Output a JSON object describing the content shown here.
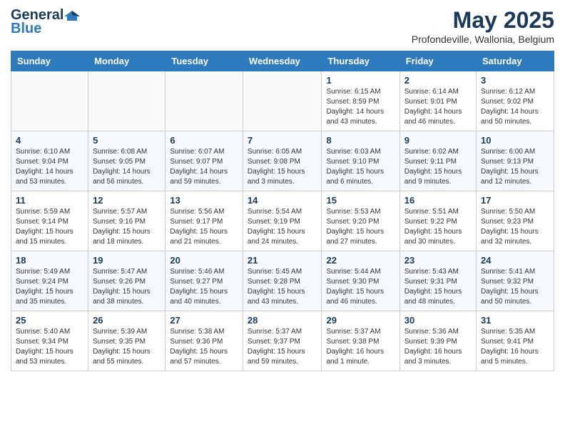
{
  "header": {
    "logo_general": "General",
    "logo_blue": "Blue",
    "month_year": "May 2025",
    "location": "Profondeville, Wallonia, Belgium"
  },
  "columns": [
    "Sunday",
    "Monday",
    "Tuesday",
    "Wednesday",
    "Thursday",
    "Friday",
    "Saturday"
  ],
  "rows": [
    [
      {
        "day": "",
        "detail": ""
      },
      {
        "day": "",
        "detail": ""
      },
      {
        "day": "",
        "detail": ""
      },
      {
        "day": "",
        "detail": ""
      },
      {
        "day": "1",
        "detail": "Sunrise: 6:15 AM\nSunset: 8:59 PM\nDaylight: 14 hours\nand 43 minutes."
      },
      {
        "day": "2",
        "detail": "Sunrise: 6:14 AM\nSunset: 9:01 PM\nDaylight: 14 hours\nand 46 minutes."
      },
      {
        "day": "3",
        "detail": "Sunrise: 6:12 AM\nSunset: 9:02 PM\nDaylight: 14 hours\nand 50 minutes."
      }
    ],
    [
      {
        "day": "4",
        "detail": "Sunrise: 6:10 AM\nSunset: 9:04 PM\nDaylight: 14 hours\nand 53 minutes."
      },
      {
        "day": "5",
        "detail": "Sunrise: 6:08 AM\nSunset: 9:05 PM\nDaylight: 14 hours\nand 56 minutes."
      },
      {
        "day": "6",
        "detail": "Sunrise: 6:07 AM\nSunset: 9:07 PM\nDaylight: 14 hours\nand 59 minutes."
      },
      {
        "day": "7",
        "detail": "Sunrise: 6:05 AM\nSunset: 9:08 PM\nDaylight: 15 hours\nand 3 minutes."
      },
      {
        "day": "8",
        "detail": "Sunrise: 6:03 AM\nSunset: 9:10 PM\nDaylight: 15 hours\nand 6 minutes."
      },
      {
        "day": "9",
        "detail": "Sunrise: 6:02 AM\nSunset: 9:11 PM\nDaylight: 15 hours\nand 9 minutes."
      },
      {
        "day": "10",
        "detail": "Sunrise: 6:00 AM\nSunset: 9:13 PM\nDaylight: 15 hours\nand 12 minutes."
      }
    ],
    [
      {
        "day": "11",
        "detail": "Sunrise: 5:59 AM\nSunset: 9:14 PM\nDaylight: 15 hours\nand 15 minutes."
      },
      {
        "day": "12",
        "detail": "Sunrise: 5:57 AM\nSunset: 9:16 PM\nDaylight: 15 hours\nand 18 minutes."
      },
      {
        "day": "13",
        "detail": "Sunrise: 5:56 AM\nSunset: 9:17 PM\nDaylight: 15 hours\nand 21 minutes."
      },
      {
        "day": "14",
        "detail": "Sunrise: 5:54 AM\nSunset: 9:19 PM\nDaylight: 15 hours\nand 24 minutes."
      },
      {
        "day": "15",
        "detail": "Sunrise: 5:53 AM\nSunset: 9:20 PM\nDaylight: 15 hours\nand 27 minutes."
      },
      {
        "day": "16",
        "detail": "Sunrise: 5:51 AM\nSunset: 9:22 PM\nDaylight: 15 hours\nand 30 minutes."
      },
      {
        "day": "17",
        "detail": "Sunrise: 5:50 AM\nSunset: 9:23 PM\nDaylight: 15 hours\nand 32 minutes."
      }
    ],
    [
      {
        "day": "18",
        "detail": "Sunrise: 5:49 AM\nSunset: 9:24 PM\nDaylight: 15 hours\nand 35 minutes."
      },
      {
        "day": "19",
        "detail": "Sunrise: 5:47 AM\nSunset: 9:26 PM\nDaylight: 15 hours\nand 38 minutes."
      },
      {
        "day": "20",
        "detail": "Sunrise: 5:46 AM\nSunset: 9:27 PM\nDaylight: 15 hours\nand 40 minutes."
      },
      {
        "day": "21",
        "detail": "Sunrise: 5:45 AM\nSunset: 9:28 PM\nDaylight: 15 hours\nand 43 minutes."
      },
      {
        "day": "22",
        "detail": "Sunrise: 5:44 AM\nSunset: 9:30 PM\nDaylight: 15 hours\nand 46 minutes."
      },
      {
        "day": "23",
        "detail": "Sunrise: 5:43 AM\nSunset: 9:31 PM\nDaylight: 15 hours\nand 48 minutes."
      },
      {
        "day": "24",
        "detail": "Sunrise: 5:41 AM\nSunset: 9:32 PM\nDaylight: 15 hours\nand 50 minutes."
      }
    ],
    [
      {
        "day": "25",
        "detail": "Sunrise: 5:40 AM\nSunset: 9:34 PM\nDaylight: 15 hours\nand 53 minutes."
      },
      {
        "day": "26",
        "detail": "Sunrise: 5:39 AM\nSunset: 9:35 PM\nDaylight: 15 hours\nand 55 minutes."
      },
      {
        "day": "27",
        "detail": "Sunrise: 5:38 AM\nSunset: 9:36 PM\nDaylight: 15 hours\nand 57 minutes."
      },
      {
        "day": "28",
        "detail": "Sunrise: 5:37 AM\nSunset: 9:37 PM\nDaylight: 15 hours\nand 59 minutes."
      },
      {
        "day": "29",
        "detail": "Sunrise: 5:37 AM\nSunset: 9:38 PM\nDaylight: 16 hours\nand 1 minute."
      },
      {
        "day": "30",
        "detail": "Sunrise: 5:36 AM\nSunset: 9:39 PM\nDaylight: 16 hours\nand 3 minutes."
      },
      {
        "day": "31",
        "detail": "Sunrise: 5:35 AM\nSunset: 9:41 PM\nDaylight: 16 hours\nand 5 minutes."
      }
    ]
  ]
}
